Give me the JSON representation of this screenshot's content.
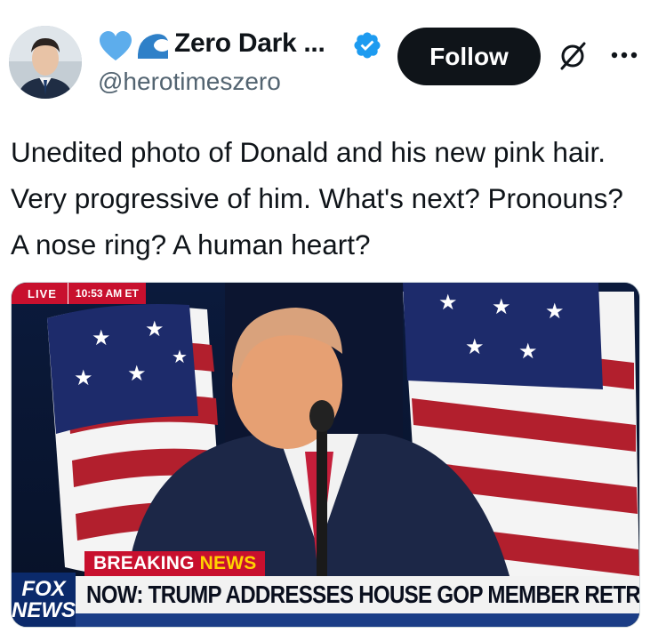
{
  "author": {
    "display_name": "Zero Dark ...",
    "handle": "@herotimeszero",
    "emojis": [
      "blue-heart-icon",
      "wave-icon"
    ],
    "verified": true
  },
  "actions": {
    "follow_label": "Follow",
    "grok_icon": "grok-icon",
    "more_icon": "more-icon"
  },
  "tweet": {
    "text": "Unedited photo of Donald and his new pink hair. Very progressive of him. What's next? Pronouns? A nose ring? A human heart?"
  },
  "media": {
    "live_label": "LIVE",
    "live_time": "10:53 AM ET",
    "breaking_label": "BREAKING",
    "breaking_news_label": "NEWS",
    "headline": "NOW: TRUMP ADDRESSES HOUSE GOP MEMBER RETREAT",
    "network_logo_line1": "FOX",
    "network_logo_line2": "NEWS"
  },
  "colors": {
    "follow_bg": "#0f1419",
    "verified_blue": "#1d9bf0",
    "fox_red": "#c8102e",
    "fox_blue": "#0b2a6b"
  }
}
